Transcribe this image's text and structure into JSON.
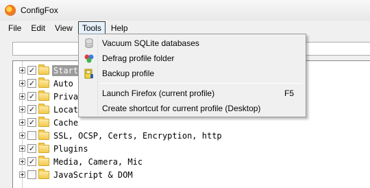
{
  "window": {
    "title": "ConfigFox"
  },
  "menubar": {
    "items": [
      "File",
      "Edit",
      "View",
      "Tools",
      "Help"
    ],
    "active": "Tools"
  },
  "search": {
    "value": ""
  },
  "tree": {
    "items": [
      {
        "label": "Startup",
        "checked": true,
        "selected": true
      },
      {
        "label": "Auto U",
        "checked": true
      },
      {
        "label": "Privac",
        "checked": true
      },
      {
        "label": "Locati",
        "checked": true
      },
      {
        "label": "Cache",
        "checked": true
      },
      {
        "label": "SSL, OCSP, Certs, Encryption, http",
        "checked": false
      },
      {
        "label": "Plugins",
        "checked": true
      },
      {
        "label": "Media, Camera, Mic",
        "checked": true
      },
      {
        "label": "JavaScript & DOM",
        "checked": false
      }
    ]
  },
  "tools_menu": {
    "items": [
      {
        "label": "Vacuum SQLite databases",
        "icon": "database-icon"
      },
      {
        "label": "Defrag profile folder",
        "icon": "defrag-icon"
      },
      {
        "label": "Backup profile",
        "icon": "backup-icon"
      },
      {
        "label": "Launch Firefox (current profile)",
        "shortcut": "F5"
      },
      {
        "label": "Create shortcut for current profile (Desktop)"
      }
    ]
  },
  "colors": {
    "selection": "#9b9b9b",
    "menu_active": "#e5f1fb",
    "folder": "#f2c94c"
  }
}
